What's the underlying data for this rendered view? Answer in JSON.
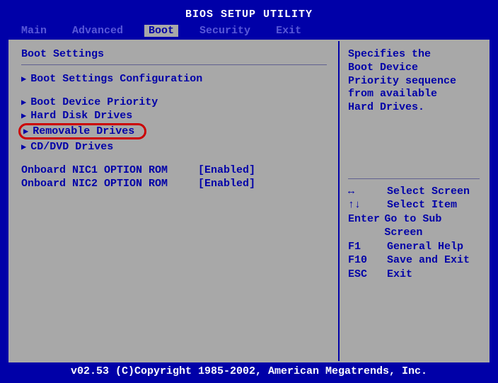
{
  "title": "BIOS SETUP UTILITY",
  "menu": {
    "items": [
      "Main",
      "Advanced",
      "Boot",
      "Security",
      "Exit"
    ],
    "active_index": 2
  },
  "left": {
    "section_title": "Boot Settings",
    "entries": [
      {
        "label": "Boot Settings Configuration"
      },
      {
        "label": "Boot Device Priority"
      },
      {
        "label": "Hard Disk Drives"
      },
      {
        "label": "Removable Drives",
        "highlighted": true
      },
      {
        "label": "CD/DVD Drives"
      }
    ],
    "options": [
      {
        "label": "Onboard NIC1 OPTION ROM",
        "value": "[Enabled]"
      },
      {
        "label": "Onboard NIC2 OPTION ROM",
        "value": "[Enabled]"
      }
    ]
  },
  "right": {
    "help_lines": [
      "Specifies the",
      "Boot Device",
      "Priority sequence",
      "from available",
      "Hard Drives."
    ],
    "keys": [
      {
        "key": "↔",
        "desc": "Select Screen"
      },
      {
        "key": "↑↓",
        "desc": "Select Item"
      },
      {
        "key": "Enter",
        "desc": "Go to Sub Screen"
      },
      {
        "key": "F1",
        "desc": "General Help"
      },
      {
        "key": "F10",
        "desc": "Save and Exit"
      },
      {
        "key": "ESC",
        "desc": "Exit"
      }
    ]
  },
  "footer": "v02.53 (C)Copyright 1985-2002, American Megatrends, Inc."
}
